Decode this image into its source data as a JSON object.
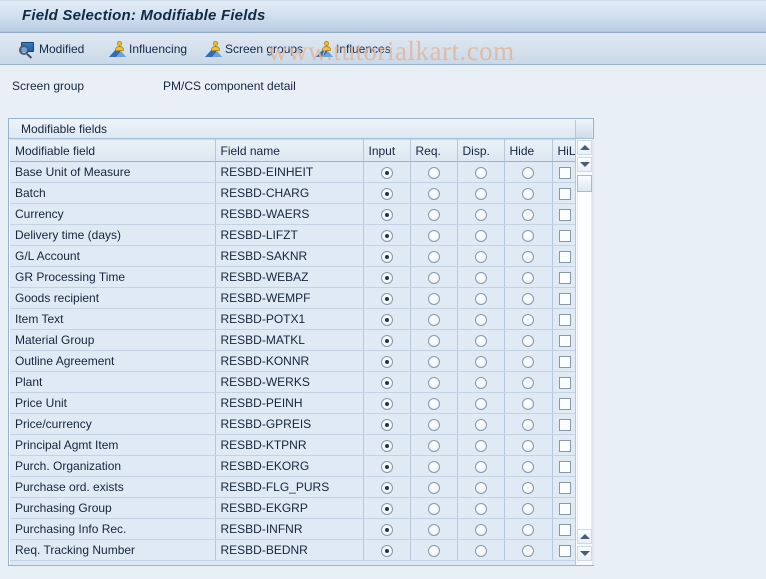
{
  "window": {
    "title": "Field Selection: Modifiable Fields"
  },
  "toolbar": {
    "buttons": [
      {
        "label": "Modified",
        "icon": "magnifier-screen-icon"
      },
      {
        "label": "Influencing",
        "icon": "person-mountain-icon"
      },
      {
        "label": "Screen groups",
        "icon": "person-mountain-icon"
      },
      {
        "label": "Influences",
        "icon": "person-mountain-icon"
      }
    ]
  },
  "watermark": {
    "text": "www.tutorialkart.com"
  },
  "screen_group": {
    "label": "Screen group",
    "value": "PM/CS component detail"
  },
  "group_box": {
    "title": "Modifiable fields"
  },
  "table": {
    "columns": [
      "Modifiable field",
      "Field name",
      "Input",
      "Req.",
      "Disp.",
      "Hide",
      "HiLi",
      ""
    ],
    "rows": [
      {
        "field": "Base Unit of Measure",
        "name": "RESBD-EINHEIT",
        "selected": "Input",
        "hili": false
      },
      {
        "field": "Batch",
        "name": "RESBD-CHARG",
        "selected": "Input",
        "hili": false
      },
      {
        "field": "Currency",
        "name": "RESBD-WAERS",
        "selected": "Input",
        "hili": false
      },
      {
        "field": "Delivery time (days)",
        "name": "RESBD-LIFZT",
        "selected": "Input",
        "hili": false
      },
      {
        "field": "G/L Account",
        "name": "RESBD-SAKNR",
        "selected": "Input",
        "hili": false
      },
      {
        "field": "GR Processing Time",
        "name": "RESBD-WEBAZ",
        "selected": "Input",
        "hili": false
      },
      {
        "field": "Goods recipient",
        "name": "RESBD-WEMPF",
        "selected": "Input",
        "hili": false
      },
      {
        "field": "Item Text",
        "name": "RESBD-POTX1",
        "selected": "Input",
        "hili": false
      },
      {
        "field": "Material Group",
        "name": "RESBD-MATKL",
        "selected": "Input",
        "hili": false
      },
      {
        "field": "Outline Agreement",
        "name": "RESBD-KONNR",
        "selected": "Input",
        "hili": false
      },
      {
        "field": "Plant",
        "name": "RESBD-WERKS",
        "selected": "Input",
        "hili": false
      },
      {
        "field": "Price Unit",
        "name": "RESBD-PEINH",
        "selected": "Input",
        "hili": false
      },
      {
        "field": "Price/currency",
        "name": "RESBD-GPREIS",
        "selected": "Input",
        "hili": false
      },
      {
        "field": "Principal Agmt Item",
        "name": "RESBD-KTPNR",
        "selected": "Input",
        "hili": false
      },
      {
        "field": "Purch. Organization",
        "name": "RESBD-EKORG",
        "selected": "Input",
        "hili": false
      },
      {
        "field": "Purchase ord. exists",
        "name": "RESBD-FLG_PURS",
        "selected": "Input",
        "hili": false
      },
      {
        "field": "Purchasing Group",
        "name": "RESBD-EKGRP",
        "selected": "Input",
        "hili": false
      },
      {
        "field": "Purchasing Info Rec.",
        "name": "RESBD-INFNR",
        "selected": "Input",
        "hili": false
      },
      {
        "field": "Req. Tracking Number",
        "name": "RESBD-BEDNR",
        "selected": "Input",
        "hili": false
      }
    ]
  },
  "scrollbar": {
    "up_icon": "arrow-up-icon",
    "down_icon": "arrow-down-icon"
  },
  "colors": {
    "title_text": "#102a43",
    "row_bg": "#dfeaf4",
    "header_bg": "#e4edf6",
    "watermark": "#e0b79d"
  }
}
